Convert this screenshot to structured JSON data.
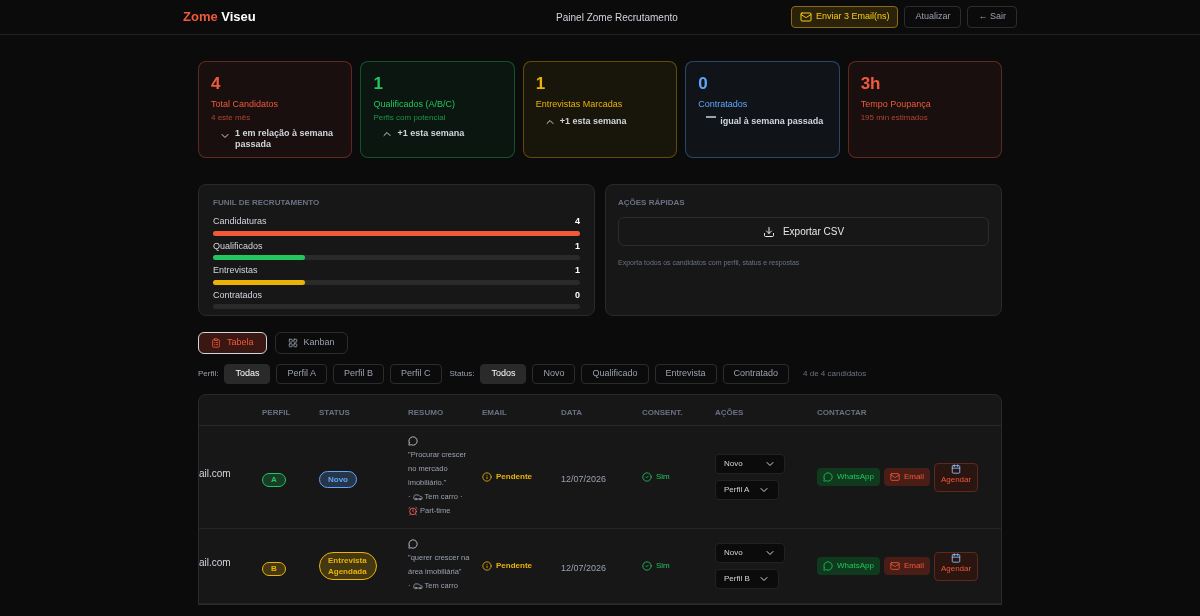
{
  "header": {
    "logo": {
      "first": "Zome",
      "second": "Viseu"
    },
    "title": "Painel Zome Recrutamento",
    "buttons": [
      {
        "label": "Enviar 3 Email(ns)",
        "kind": "primary"
      },
      {
        "label": "Atualizar",
        "kind": "plain"
      },
      {
        "label": "← Sair",
        "kind": "plain"
      }
    ]
  },
  "stats": [
    {
      "value": "4",
      "label": "Total Candidatos",
      "sub": "4 este mês",
      "trend": {
        "kind": "down",
        "text": "1 em relação à semana passada"
      },
      "color": "#ef5a3c"
    },
    {
      "value": "1",
      "label": "Qualificados (A/B/C)",
      "sub": "Perfis com potencial",
      "trend": {
        "kind": "up",
        "text": "+1 esta semana"
      },
      "color": "#22c55e"
    },
    {
      "value": "1",
      "label": "Entrevistas Marcadas",
      "trend": {
        "kind": "up",
        "text": "+1 esta semana"
      },
      "color": "#eab308"
    },
    {
      "value": "0",
      "label": "Contratados",
      "trend": {
        "kind": "flat",
        "text": "igual à semana passada"
      },
      "color": "#60a5fa"
    },
    {
      "value": "3h",
      "label": "Tempo Poupança",
      "sub": "195 min estimados",
      "color": "#ef5a3c"
    }
  ],
  "funnel": {
    "title": "FUNIL DE RECRUTAMENTO",
    "stages": [
      {
        "label": "Candidaturas",
        "count": "4",
        "level": 1,
        "color": "#f0593a"
      },
      {
        "label": "Qualificados",
        "count": "1",
        "level": 0.25,
        "color": "#22c55e"
      },
      {
        "label": "Entrevistas",
        "count": "1",
        "level": 0.25,
        "color": "#eab308"
      },
      {
        "label": "Contratados",
        "count": "0",
        "level": 0
      }
    ]
  },
  "quick_actions": {
    "title": "AÇÕES RÁPIDAS",
    "button": "Exportar CSV",
    "note": "Exporta todos os candidatos com perfil, status e respostas"
  },
  "views": [
    {
      "label": "Tabela",
      "kind": "table",
      "selected": true
    },
    {
      "label": "Kanban",
      "kind": "kanban",
      "selected": false
    }
  ],
  "filters": {
    "profile_label": "Perfil:",
    "profiles": [
      {
        "label": "Todas",
        "selected": true
      },
      {
        "label": "Perfil A",
        "selected": false
      },
      {
        "label": "Perfil B",
        "selected": false
      },
      {
        "label": "Perfil C",
        "selected": false
      }
    ],
    "status_label": "Status:",
    "statuses": [
      {
        "label": "Todos",
        "selected": true
      },
      {
        "label": "Novo",
        "selected": false
      },
      {
        "label": "Qualificado",
        "selected": false
      },
      {
        "label": "Entrevista",
        "selected": false
      },
      {
        "label": "Contratado",
        "selected": false
      }
    ],
    "count": "4 de 4 candidatos"
  },
  "table": {
    "columns": [
      "",
      "PERFIL",
      "STATUS",
      "RESUMO",
      "EMAIL",
      "DATA",
      "CONSENT.",
      "AÇÕES",
      "CONTACTAR"
    ],
    "rows": [
      {
        "column_1": "ail.com",
        "profile": {
          "label": "A",
          "color": "#22c55e"
        },
        "status": {
          "label": "Novo",
          "color": "#60a5fa"
        },
        "summary": {
          "quote": "\"Procurar crescer no mercado imobiliário.\"",
          "tags": [
            {
              "sep": "·",
              "kind": "car",
              "text": "Tem carro"
            },
            {
              "sep": "·",
              "kind": "clock",
              "text": "Part-time"
            }
          ]
        },
        "email": "Pendente",
        "date": "12/07/2026",
        "consent": "Sim",
        "status_select": "Novo",
        "profile_select": "Perfil A",
        "contacts": [
          "WhatsApp",
          "Email",
          "Agendar"
        ]
      },
      {
        "column_1": "ail.com",
        "profile": {
          "label": "B",
          "color": "#eab308"
        },
        "status": {
          "label": "Entrevista Agendada",
          "color": "#eab308"
        },
        "summary": {
          "quote": "\"querer crescer na área imobiliária\"",
          "tags": [
            {
              "sep": "·",
              "kind": "car",
              "text": "Tem carro"
            }
          ]
        },
        "email": "Pendente",
        "date": "12/07/2026",
        "consent": "Sim",
        "status_select": "Novo",
        "profile_select": "Perfil B",
        "contacts": [
          "WhatsApp",
          "Email",
          "Agendar"
        ]
      }
    ]
  }
}
